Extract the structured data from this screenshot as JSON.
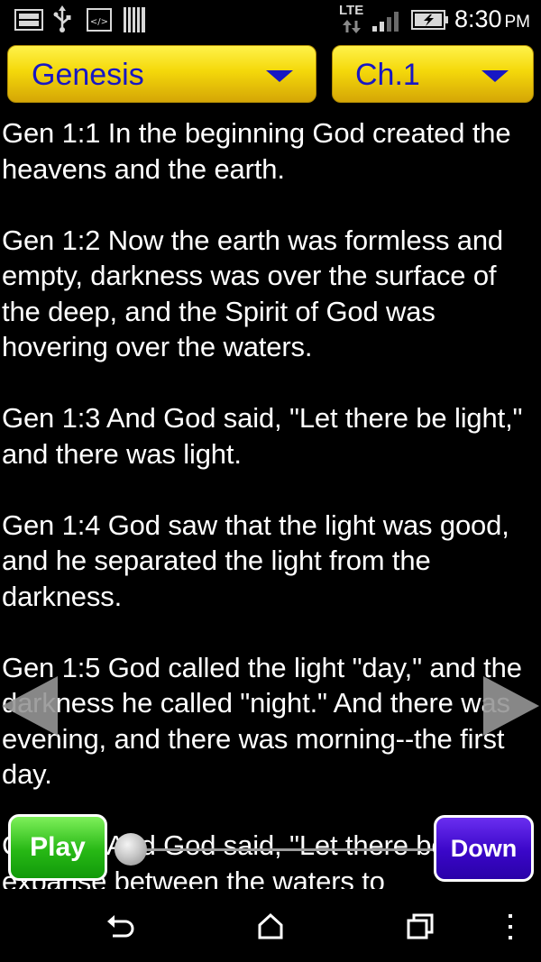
{
  "status_bar": {
    "network": "LTE",
    "time": "8:30",
    "ampm": "PM",
    "icons": [
      "image-icon",
      "usb-icon",
      "code-icon",
      "barcode-icon",
      "lte-icon",
      "signal-icon",
      "battery-icon"
    ]
  },
  "selectors": {
    "book": "Genesis",
    "chapter": "Ch.1",
    "text_color": "#1717c4"
  },
  "verses": [
    "Gen 1:1 In the beginning God created the heavens and the earth.",
    "Gen 1:2 Now the earth was formless and empty, darkness was over the surface of the deep, and the  Spirit of God was hovering over the waters.",
    "Gen 1:3 And God said, \"Let there be light,\" and there was light.",
    "Gen 1:4 God saw that the light was good, and he separated the light from the darkness.",
    "Gen 1:5 God called the light \"day,\" and the darkness he called \"night.\" And there was evening, and  there was morning--the first day.",
    "Gen 1:6 And God said, \"Let there be an expanse between the waters to"
  ],
  "controls": {
    "play_label": "Play",
    "down_label": "Down",
    "progress": 0.0
  },
  "nav_bar": {
    "icons": [
      "back-icon",
      "home-icon",
      "recents-icon",
      "menu-icon"
    ]
  }
}
